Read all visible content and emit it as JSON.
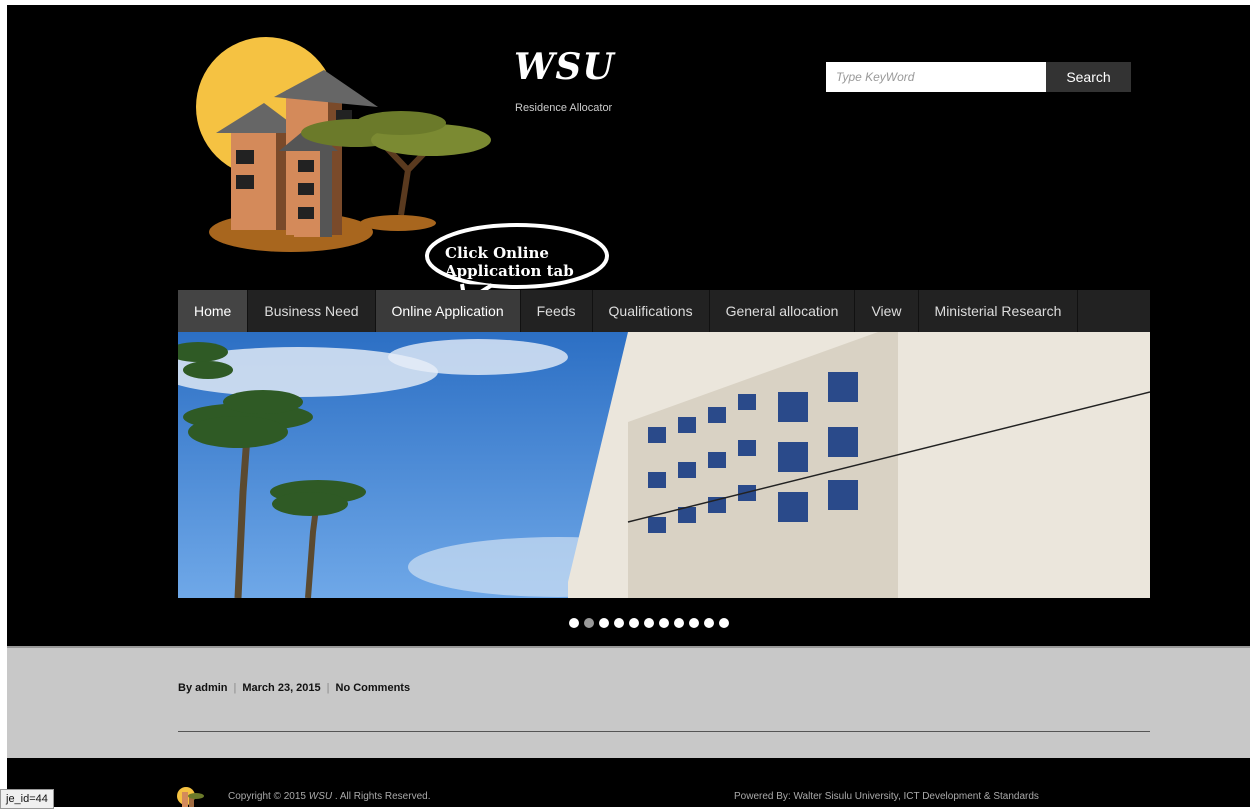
{
  "site": {
    "title": "WSU",
    "tagline": "Residence Allocator"
  },
  "search": {
    "placeholder": "Type KeyWord",
    "button_label": "Search"
  },
  "callout": {
    "line1": "Click Online",
    "line2": "Application tab"
  },
  "nav": {
    "items": [
      {
        "label": "Home",
        "state": "active"
      },
      {
        "label": "Business Need"
      },
      {
        "label": "Online Application",
        "state": "hover"
      },
      {
        "label": "Feeds"
      },
      {
        "label": "Qualifications"
      },
      {
        "label": "General allocation"
      },
      {
        "label": "View"
      },
      {
        "label": "Ministerial Research"
      }
    ]
  },
  "slider": {
    "dot_count": 11,
    "active_index": 1
  },
  "post_meta": {
    "author": "By admin",
    "date": "March 23, 2015",
    "comments": "No Comments",
    "separator": "|"
  },
  "footer": {
    "copyright_prefix": "Copyright © 2015",
    "copyright_brand": "WSU",
    "copyright_suffix": ". All Rights Reserved.",
    "powered": "Powered By: Walter Sisulu University, ICT Development & Standards"
  },
  "status_bar": {
    "url_text": "je_id=44"
  },
  "colors": {
    "header_bg": "#000000",
    "content_bg": "#c8c8c8",
    "nav_bg": "#222222",
    "sky": "#3b82d6"
  }
}
